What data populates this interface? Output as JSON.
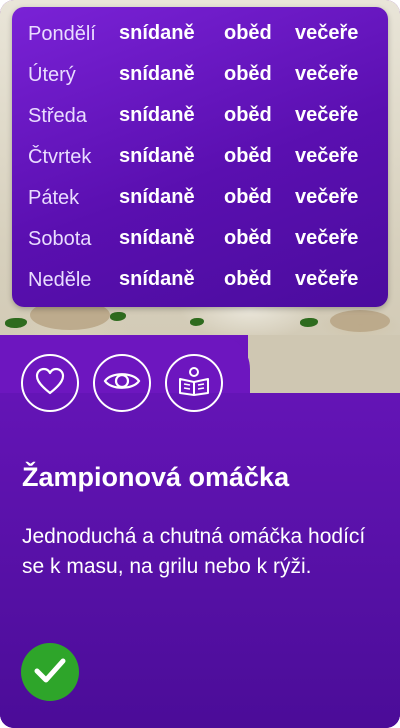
{
  "week": [
    {
      "day": "Pondělí",
      "breakfast": "snídaně",
      "lunch": "oběd",
      "dinner": "večeře"
    },
    {
      "day": "Úterý",
      "breakfast": "snídaně",
      "lunch": "oběd",
      "dinner": "večeře"
    },
    {
      "day": "Středa",
      "breakfast": "snídaně",
      "lunch": "oběd",
      "dinner": "večeře"
    },
    {
      "day": "Čtvrtek",
      "breakfast": "snídaně",
      "lunch": "oběd",
      "dinner": "večeře"
    },
    {
      "day": "Pátek",
      "breakfast": "snídaně",
      "lunch": "oběd",
      "dinner": "večeře"
    },
    {
      "day": "Sobota",
      "breakfast": "snídaně",
      "lunch": "oběd",
      "dinner": "večeře"
    },
    {
      "day": "Neděle",
      "breakfast": "snídaně",
      "lunch": "oběd",
      "dinner": "večeře"
    }
  ],
  "actions": {
    "favorite_icon": "heart-icon",
    "view_icon": "eye-icon",
    "read_icon": "book-reader-icon",
    "done_icon": "checkmark-icon"
  },
  "recipe": {
    "title": "Žampionová omáčka",
    "description": "Jednoduchá a chutná omáčka hodící se k masu, na grilu nebo k rýži."
  },
  "colors": {
    "primary": "#6a14b4",
    "success": "#2ea52a"
  }
}
